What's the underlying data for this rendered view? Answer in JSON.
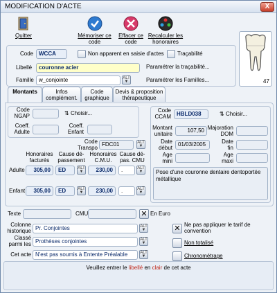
{
  "window": {
    "title": "MODIFICATION D'ACTE",
    "close_glyph": "X"
  },
  "toolbar": {
    "quitter": "Quitter",
    "memoriser": [
      "Mémoriser ce",
      "code"
    ],
    "effacer": [
      "Effacer ce",
      "code"
    ],
    "recalculer": [
      "Recalculer les",
      "honoraires"
    ]
  },
  "header": {
    "code_label": "Code",
    "code_value": "WCCA",
    "non_apparent_label": "Non apparent en saisie d'actes",
    "tracabilite_label": "Traçabilité",
    "libelle_label": "Libellé",
    "libelle_value": "couronne acier",
    "param_tracabilite": "Paramétrer la traçabilité...",
    "famille_label": "Famille",
    "famille_value": "w_conjointe",
    "param_familles": "Paramétrer les Familles...",
    "tooth_number": "47"
  },
  "tabs": [
    {
      "label": "Montants"
    },
    {
      "label": "Infos complément."
    },
    {
      "label": "Code graphique"
    },
    {
      "label": "Devis & proposition thérapeutique"
    }
  ],
  "ngap": {
    "code_label": [
      "Code",
      "NGAP"
    ],
    "choisir": "Choisir...",
    "coeff_adulte": [
      "Coeff.",
      "Adulte"
    ],
    "coeff_enfant": [
      "Coeff.",
      "Enfant"
    ]
  },
  "ccam": {
    "code_label": [
      "Code",
      "CCAM"
    ],
    "code_value": "HBLD038",
    "choisir": "Choisir...",
    "montant_label": [
      "Montant",
      "unitaire"
    ],
    "montant_value": "107,50",
    "majoration_label": [
      "Majoration",
      "DOM"
    ],
    "date_debut_label": [
      "Date",
      "début"
    ],
    "date_debut_value": "01/03/2005",
    "date_fin_label": [
      "Date",
      "fin"
    ],
    "age_mini_label": [
      "Age",
      "mini"
    ],
    "age_maxi_label": [
      "Age",
      "maxi"
    ],
    "description": "Pose d'une couronne dentaire dentoportée métallique"
  },
  "honoraires": {
    "code_transpo_label": [
      "Code",
      "Transpo"
    ],
    "code_transpo_value": "FDC01",
    "col_honoraires": [
      "Honoraires",
      "facturés"
    ],
    "col_cause_dep": [
      "Cause dé-",
      "passement"
    ],
    "col_hono_cmu": [
      "Honoraires",
      "C.M.U."
    ],
    "col_cause_cmu": [
      "Cause dé-",
      "pas. CMU"
    ],
    "rows": [
      {
        "label": "Adulte",
        "honoraires": "305,00",
        "cause": "ED",
        "cmu": "230,00",
        "cause_cmu": "."
      },
      {
        "label": "Enfant",
        "honoraires": "305,00",
        "cause": "ED",
        "cmu": "230,00",
        "cause_cmu": "."
      }
    ]
  },
  "bottom": {
    "texte_label": "Texte",
    "cmu_label": "CMU",
    "en_euro_label": "En Euro",
    "colonne_hist_label": [
      "Colonne",
      "historique"
    ],
    "colonne_hist_value": "Pr. Conjointes",
    "classe_label": [
      "Classé",
      "parmi les"
    ],
    "classe_value": "Prothèses conjointes",
    "cet_acte_label": "Cet acte",
    "cet_acte_value": "N'est pas soumis à Entente Préalable",
    "ne_pas_appliquer": [
      "Ne pas appliquer le tarif de",
      "convention"
    ],
    "non_totalise": "Non totalisé",
    "chronometrage": "Chronométrage"
  },
  "status": {
    "part1": "Veuillez entrer le ",
    "libelle": "libellé",
    "part2": " en ",
    "clair": "clair",
    "part3": " de cet acte"
  },
  "colors": {
    "accent_red": "#c0281a",
    "field_blue": "#0a2a6a",
    "highlight_yellow": "#ffffc8"
  }
}
